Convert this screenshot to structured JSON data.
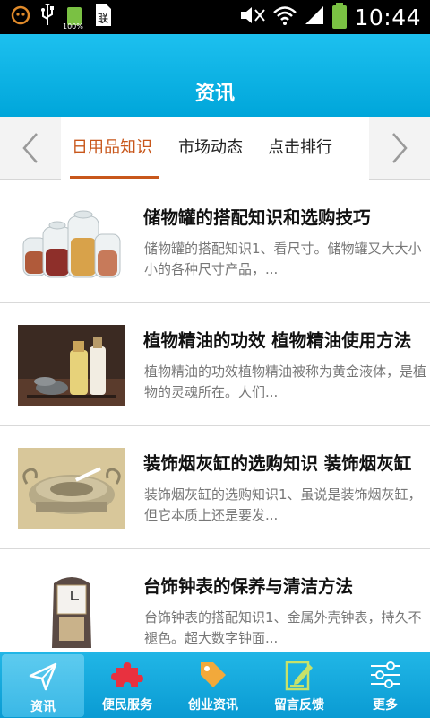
{
  "status_bar": {
    "time": "10:44",
    "battery_small_label": "100%",
    "icons": [
      "debug-icon",
      "usb-icon",
      "battery-icon",
      "sim-icon",
      "mute-icon",
      "wifi-icon",
      "signal-icon",
      "battery-full-icon"
    ]
  },
  "header": {
    "title": "资讯"
  },
  "tabs": {
    "items": [
      {
        "label": "日用品知识",
        "active": true
      },
      {
        "label": "市场动态",
        "active": false
      },
      {
        "label": "点击排行",
        "active": false
      }
    ],
    "prev_icon": "chevron-left-icon",
    "next_icon": "chevron-right-icon"
  },
  "news": [
    {
      "title": "储物罐的搭配知识和选购技巧",
      "desc": "储物罐的搭配知识1、看尺寸。储物罐又大大小小的各种尺寸产品，..."
    },
    {
      "title": "植物精油的功效 植物精油使用方法",
      "desc": "植物精油的功效植物精油被称为黄金液体，是植物的灵魂所在。人们..."
    },
    {
      "title": "装饰烟灰缸的选购知识 装饰烟灰缸",
      "desc": "装饰烟灰缸的选购知识1、虽说是装饰烟灰缸，但它本质上还是要发..."
    },
    {
      "title": "台饰钟表的保养与清洁方法",
      "desc": "台饰钟表的搭配知识1、金属外壳钟表，持久不褪色。超大数字钟面..."
    }
  ],
  "bottom_nav": [
    {
      "label": "资讯",
      "icon": "send-icon",
      "active": true
    },
    {
      "label": "便民服务",
      "icon": "puzzle-icon",
      "active": false
    },
    {
      "label": "创业资讯",
      "icon": "tag-icon",
      "active": false
    },
    {
      "label": "留言反馈",
      "icon": "edit-icon",
      "active": false
    },
    {
      "label": "更多",
      "icon": "sliders-icon",
      "active": false
    }
  ],
  "colors": {
    "accent": "#c8571b",
    "header": "#00a6da",
    "nav": "#0a9bd3"
  }
}
